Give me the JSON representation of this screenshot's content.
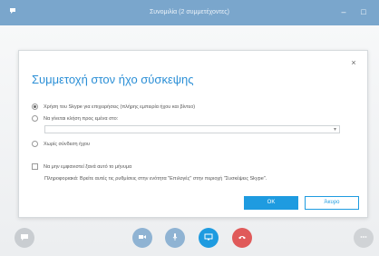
{
  "window": {
    "title": "Συνομιλία (2 συμμετέχοντες)",
    "minimize_glyph": "–",
    "maximize_glyph": "□"
  },
  "dialog": {
    "title": "Συμμετοχή στον ήχο σύσκεψης",
    "close_glyph": "×",
    "options": [
      {
        "label": "Χρήση του Skype για επιχειρήσεις (πλήρης εμπειρία ήχου και βίντεο)",
        "selected": true
      },
      {
        "label": "Να γίνεται κλήση προς εμένα στο:",
        "selected": false
      },
      {
        "label": "Χωρίς σύνδεση ήχου",
        "selected": false
      }
    ],
    "select_value": "",
    "checkbox_label": "Να μην εμφανιστεί ξανά αυτό το μήνυμα",
    "info_text": "Πληροφοριακά: Βρείτε αυτές τις ρυθμίσεις στην ενότητα \"Επιλογές\" στην περιοχή \"Συσκέψεις Skype\".",
    "ok_label": "OK",
    "cancel_label": "Άκυρο"
  },
  "callbar": {
    "icons": [
      "chat-icon",
      "video-icon",
      "mic-icon",
      "screen-share-icon",
      "hangup-icon",
      "more-icon"
    ]
  },
  "colors": {
    "accent": "#1e9be0",
    "titlebar": "#7aa6cc",
    "hangup": "#e05a5a"
  }
}
